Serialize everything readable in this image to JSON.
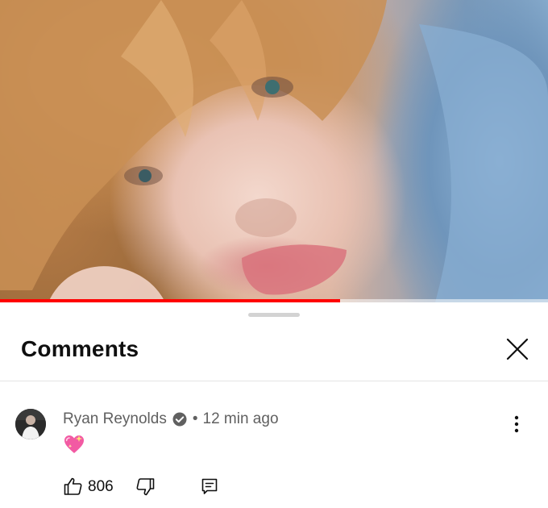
{
  "video": {
    "progress_fraction": 0.62,
    "buffered_fraction": 0.75
  },
  "comments_panel": {
    "title": "Comments",
    "close_icon": "close-icon"
  },
  "comment": {
    "author": "Ryan Reynolds",
    "verified_icon": "verified-check-icon",
    "separator": "•",
    "time": "12 min ago",
    "text_emoji": "sparkling-heart-emoji",
    "likes": "806",
    "like_icon": "thumbs-up-icon",
    "dislike_icon": "thumbs-down-icon",
    "reply_icon": "reply-icon",
    "more_icon": "more-vertical-icon"
  },
  "colors": {
    "progress": "#ff0000",
    "text_primary": "#0f0f0f",
    "text_secondary": "#606060"
  }
}
